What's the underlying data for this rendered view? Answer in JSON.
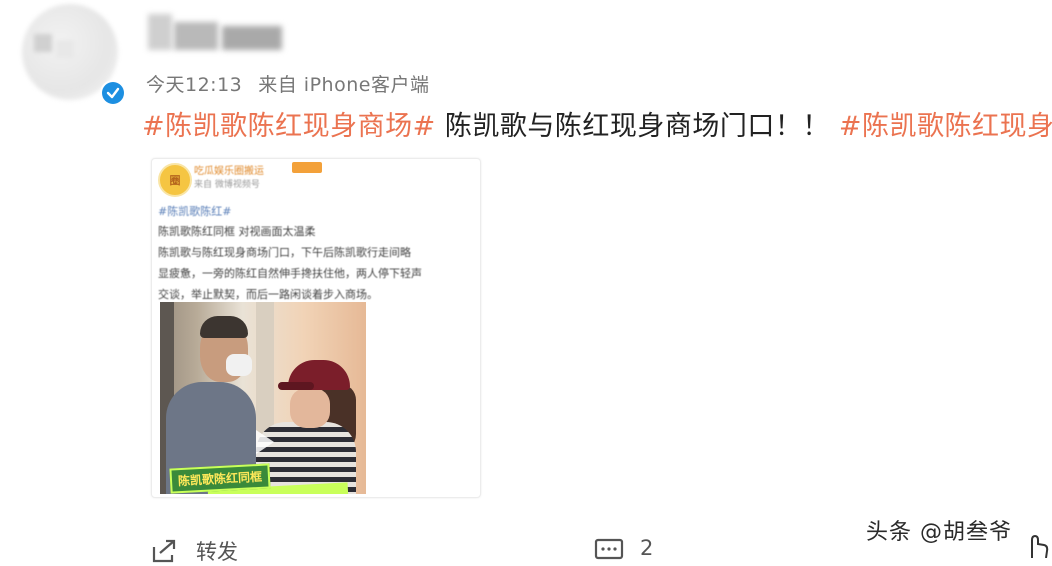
{
  "header": {
    "timestamp": "今天12:13",
    "source": "来自 iPhone客户端"
  },
  "post": {
    "tag1": "#陈凯歌陈红现身商场#",
    "body": " 陈凯歌与陈红现身商场门口！！ ",
    "tag2": "#陈凯歌陈红现身#"
  },
  "attachment": {
    "avatar_text": "圈",
    "name": "吃瓜娱乐圈搬运",
    "sub": "来自 微博视频号",
    "tag": "#陈凯歌陈红#",
    "lines": [
      "陈凯歌陈红同框 对视画面太温柔",
      "陈凯歌与陈红现身商场门口，下午后陈凯歌行走间略",
      "显疲惫，一旁的陈红自然伸手搀扶住他，两人停下轻声",
      "交谈，举止默契，而后一路闲谈着步入商场。"
    ],
    "video_caption": "陈凯歌陈红同框"
  },
  "actions": {
    "repost_label": "转发",
    "comment_count": "2"
  },
  "watermark": "头条 @胡叁爷",
  "colors": {
    "tag": "#eb7350",
    "verify": "#1d8fe1",
    "meta": "#777777"
  }
}
